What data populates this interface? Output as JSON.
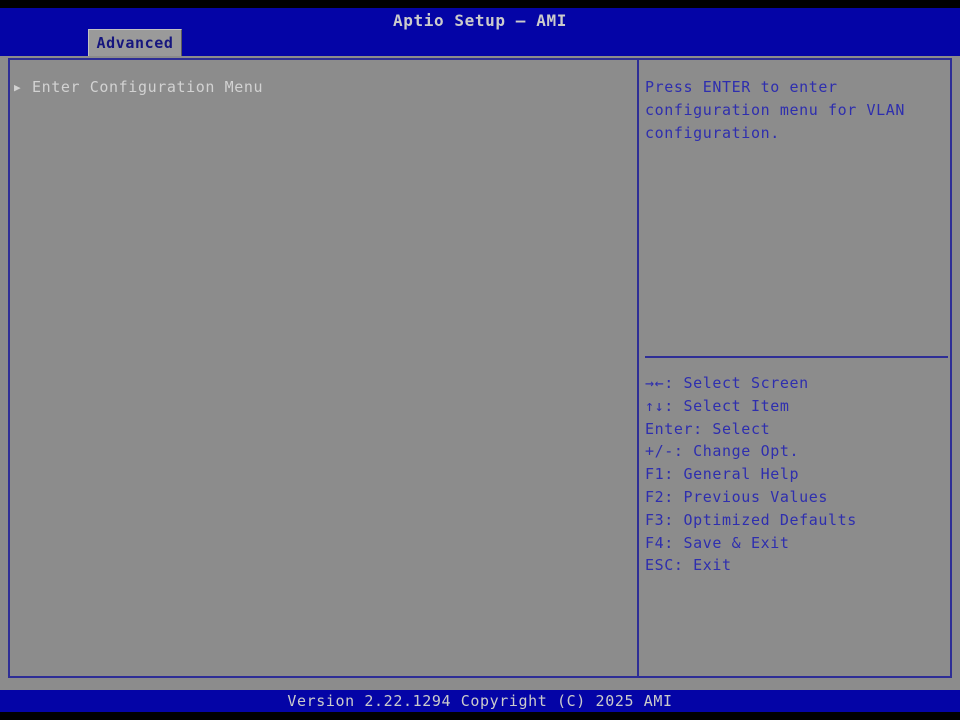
{
  "window": {
    "title": "Aptio Setup – AMI",
    "footer_text": "Version 2.22.1294 Copyright (C) 2025 AMI"
  },
  "tabs": [
    {
      "label": "Advanced",
      "active": true
    }
  ],
  "menu": {
    "arrow_glyph": "▶",
    "items": [
      {
        "label": "Enter Configuration Menu",
        "selected": true
      }
    ]
  },
  "help_panel": {
    "text": "Press ENTER to enter configuration menu for VLAN configuration."
  },
  "hotkeys": [
    {
      "text": "→←: Select Screen"
    },
    {
      "text": "↑↓: Select Item"
    },
    {
      "text": "Enter: Select"
    },
    {
      "text": "+/-: Change Opt."
    },
    {
      "text": "F1: General Help"
    },
    {
      "text": "F2: Previous Values"
    },
    {
      "text": "F3: Optimized Defaults"
    },
    {
      "text": "F4: Save & Exit"
    },
    {
      "text": "ESC: Exit"
    }
  ],
  "colors": {
    "header_blue": "#0404a6",
    "background_gray": "#8c8c8c",
    "panel_border_navy": "#2e2e96",
    "help_text_blue": "#2e2eae",
    "selected_item_text": "#d2d2d2",
    "tab_text_navy": "#16167e"
  }
}
